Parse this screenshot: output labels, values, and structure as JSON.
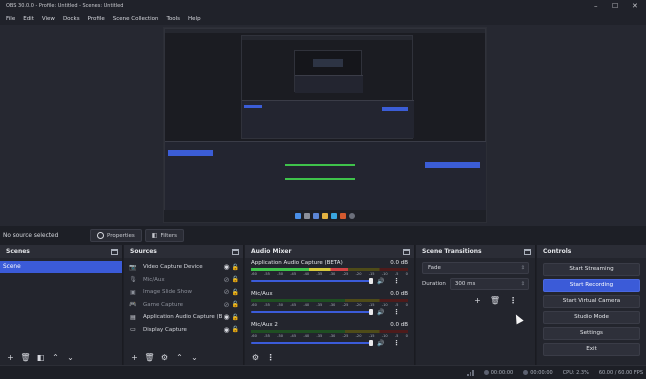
{
  "window": {
    "title": "OBS 30.0.0 - Profile: Untitled - Scenes: Untitled",
    "controls": [
      "–",
      "☐",
      "✕"
    ]
  },
  "menu": [
    "File",
    "Edit",
    "View",
    "Docks",
    "Profile",
    "Scene Collection",
    "Tools",
    "Help"
  ],
  "source_toolbar": {
    "status": "No source selected",
    "properties": "Properties",
    "filters": "Filters"
  },
  "scenes": {
    "title": "Scenes",
    "items": [
      "Scene"
    ]
  },
  "sources": {
    "title": "Sources",
    "items": [
      {
        "name": "Video Capture Device",
        "icon": "camera-icon"
      },
      {
        "name": "Mic/Aux",
        "icon": "microphone-icon"
      },
      {
        "name": "Image Slide Show",
        "icon": "slideshow-icon"
      },
      {
        "name": "Game Capture",
        "icon": "gamepad-icon"
      },
      {
        "name": "Application Audio Capture (BETA)",
        "icon": "application-icon"
      },
      {
        "name": "Display Capture",
        "icon": "monitor-icon"
      }
    ]
  },
  "audio_mixer": {
    "title": "Audio Mixer",
    "ticks": [
      "-60",
      "-55",
      "-50",
      "-45",
      "-40",
      "-35",
      "-30",
      "-25",
      "-20",
      "-15",
      "-10",
      "-5",
      "0"
    ],
    "channels": [
      {
        "name": "Application Audio Capture (BETA)",
        "db": "0.0 dB",
        "level": 0.62,
        "volume": 1.0
      },
      {
        "name": "Mic/Aux",
        "db": "0.0 dB",
        "level": 0.0,
        "volume": 1.0
      },
      {
        "name": "Mic/Aux 2",
        "db": "0.0 dB",
        "level": 0.0,
        "volume": 1.0
      }
    ]
  },
  "transitions": {
    "title": "Scene Transitions",
    "selected": "Fade",
    "duration_label": "Duration",
    "duration_value": "300 ms"
  },
  "controls": {
    "title": "Controls",
    "buttons": [
      "Start Streaming",
      "Start Recording",
      "Start Virtual Camera",
      "Studio Mode",
      "Settings",
      "Exit"
    ]
  },
  "status": {
    "stream_time": "00:00:00",
    "record_time": "00:00:00",
    "cpu": "CPU: 2.3%",
    "fps": "60.00 / 60.00 FPS"
  },
  "colors": {
    "accent": "#3b5bd8",
    "panel": "#23252d",
    "title": "#2b2d36"
  }
}
